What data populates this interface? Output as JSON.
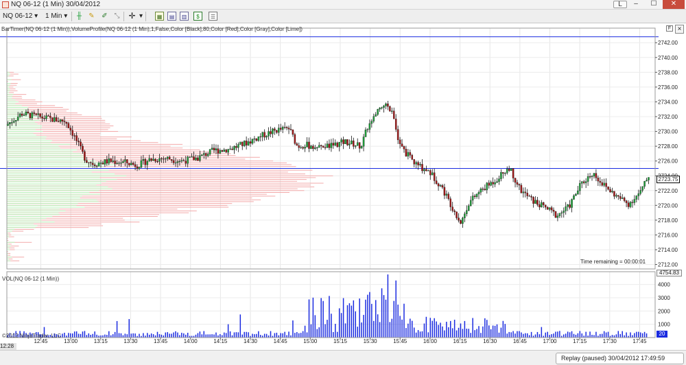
{
  "window": {
    "title": "NQ 06-12 (1 Min)  30/04/2012",
    "letter_button": "L",
    "min_glyph": "–",
    "max_glyph": "☐",
    "close_glyph": "✕"
  },
  "toolbar": {
    "instrument": "NQ 06-12",
    "interval": "1 Min",
    "dropdown_glyph": "▾"
  },
  "chart": {
    "indicators_label": "BarTimer(NQ 06-12 (1 Min)),VolumeProfile(NQ 06-12 (1 Min),1,False,Color [Black],80,Color [Red],Color [Gray],Color [Lime])",
    "header_button": "F",
    "close_button": "×",
    "price_ticks": [
      "2742.00",
      "2740.00",
      "2738.00",
      "2736.00",
      "2734.00",
      "2732.00",
      "2730.00",
      "2728.00",
      "2726.00",
      "2724.00",
      "2722.00",
      "2720.00",
      "2718.00",
      "2716.00",
      "2714.00",
      "2712.00"
    ],
    "price_ticks_num": [
      2742,
      2740,
      2738,
      2736,
      2734,
      2732,
      2730,
      2728,
      2726,
      2724,
      2722,
      2720,
      2718,
      2716,
      2714,
      2712
    ],
    "price_range": [
      2711.4,
      2743.6
    ],
    "last_price": "2723.75",
    "top_line_price": 2742.8,
    "mid_line_price": 2725.0,
    "time_remaining": "Time remaining = 00:00:01",
    "start_time": "12:28",
    "time_ticks": [
      "12:45",
      "13:00",
      "13:15",
      "13:30",
      "13:45",
      "14:00",
      "14:15",
      "14:30",
      "14:45",
      "15:00",
      "15:15",
      "15:30",
      "15:45",
      "16:00",
      "16:15",
      "16:30",
      "16:45",
      "17:00",
      "17:15",
      "17:30",
      "17:45"
    ],
    "volume_label": "VOL(NQ 06-12 (1 Min))",
    "volume_max": "4754.83",
    "volume_ticks": [
      "4000",
      "3000",
      "2000",
      "1000"
    ],
    "volume_ticks_num": [
      4000,
      3000,
      2000,
      1000
    ],
    "volume_last": "20",
    "copyright": "©2012 NinjaTrader, LLC",
    "colors": {
      "up": "#1f9e3a",
      "down": "#a01818",
      "line": "#1a2be0",
      "profile_red": "#f3a9a9",
      "profile_green": "#b9f0b9"
    }
  },
  "status": {
    "replay": "Replay (paused) 30/04/2012 17:49:59"
  }
}
